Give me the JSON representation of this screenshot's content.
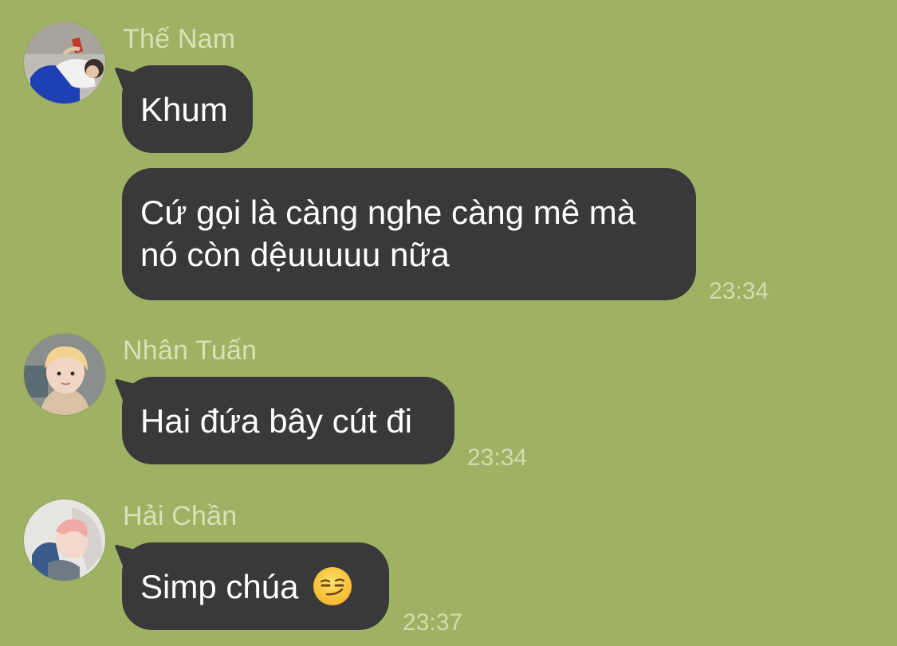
{
  "colors": {
    "background": "#9fb263",
    "bubble": "#39393b",
    "bubble_text": "#ffffff",
    "sender_text": "#d7e2b6",
    "time_text": "#d2dcae"
  },
  "messages": [
    {
      "sender": "Thế Nam",
      "avatar_icon": "avatar-the-nam",
      "bubbles": [
        {
          "text": "Khum"
        },
        {
          "line1": "Cứ gọi là càng nghe càng mê mà",
          "line2": "nó còn dệuuuuu nữa"
        }
      ],
      "time": "23:34"
    },
    {
      "sender": "Nhân Tuấn",
      "avatar_icon": "avatar-nhan-tuan",
      "bubbles": [
        {
          "text": "Hai đứa bây cút đi"
        }
      ],
      "time": "23:34"
    },
    {
      "sender": "Hải Chần",
      "avatar_icon": "avatar-hai-chan",
      "bubbles": [
        {
          "text": "Simp chúa",
          "emoji": "smirking-face-emoji"
        }
      ],
      "time": "23:37"
    }
  ]
}
